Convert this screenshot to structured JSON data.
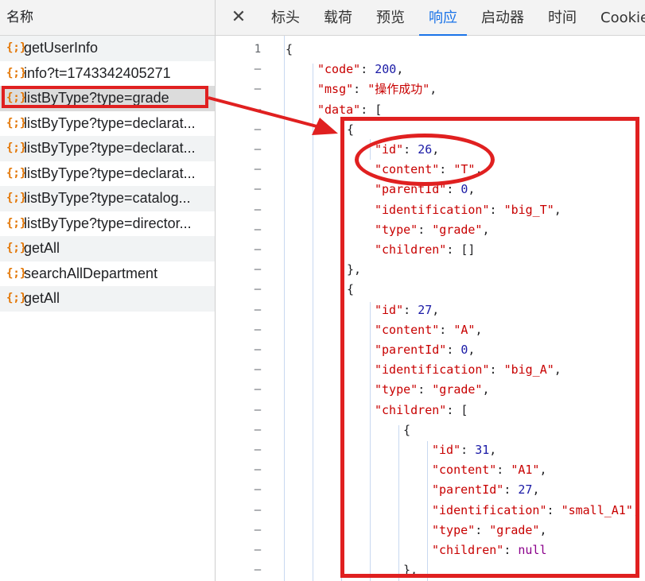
{
  "request_list": {
    "header": "名称",
    "icon_glyph": "{;}",
    "items": [
      {
        "name": "getUserInfo"
      },
      {
        "name": "info?t=1743342405271"
      },
      {
        "name": "listByType?type=grade"
      },
      {
        "name": "listByType?type=declarat..."
      },
      {
        "name": "listByType?type=declarat..."
      },
      {
        "name": "listByType?type=declarat..."
      },
      {
        "name": "listByType?type=catalog..."
      },
      {
        "name": "listByType?type=director..."
      },
      {
        "name": "getAll"
      },
      {
        "name": "searchAllDepartment"
      },
      {
        "name": "getAll"
      }
    ]
  },
  "tabs": {
    "close_glyph": "✕",
    "items": [
      {
        "label": "标头"
      },
      {
        "label": "载荷"
      },
      {
        "label": "预览"
      },
      {
        "label": "响应"
      },
      {
        "label": "启动器"
      },
      {
        "label": "时间"
      },
      {
        "label": "Cookie"
      }
    ],
    "active": "响应"
  },
  "response": {
    "line_number": "1",
    "collapse_mark": "–",
    "lines": [
      "{",
      "\"code\": 200,",
      "\"msg\": \"操作成功\",",
      "\"data\": [",
      "{",
      "\"id\": 26,",
      "\"content\": \"T\",",
      "\"parentId\": 0,",
      "\"identification\": \"big_T\",",
      "\"type\": \"grade\",",
      "\"children\": []",
      "},",
      "{",
      "\"id\": 27,",
      "\"content\": \"A\",",
      "\"parentId\": 0,",
      "\"identification\": \"big_A\",",
      "\"type\": \"grade\",",
      "\"children\": [",
      "{",
      "\"id\": 31,",
      "\"content\": \"A1\",",
      "\"parentId\": 27,",
      "\"identification\": \"small_A1\",",
      "\"type\": \"grade\",",
      "\"children\": null",
      "},"
    ]
  },
  "colors": {
    "accent": "#1a73e8",
    "annotation_red": "#e02020",
    "json_key": "#c80000",
    "json_number": "#1a1aa6"
  }
}
